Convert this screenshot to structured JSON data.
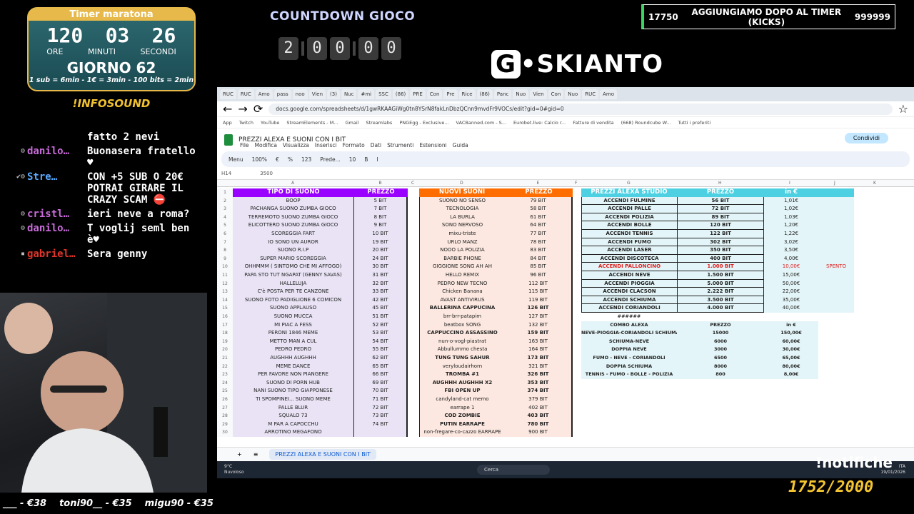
{
  "timer": {
    "title": "Timer maratona",
    "hours": "120",
    "minutes": "03",
    "seconds": "26",
    "hours_label": "ORE",
    "minutes_label": "MINUTI",
    "seconds_label": "SECONDI",
    "day": "GIORNO 62",
    "rates": "1 sub = 6min - 1€ = 3min - 100 bits = 2min"
  },
  "infosound": "!INFOSOUND",
  "chat": [
    {
      "badge": "",
      "user": "",
      "user_color": "#ffffff",
      "msg": "fatto 2 nevi"
    },
    {
      "badge": "⚙",
      "user": "danilo…",
      "user_color": "#c86bd9",
      "msg": "Buonasera fratello ♥"
    },
    {
      "badge": "✔⚙",
      "user": "Stre…",
      "user_color": "#5aa9ff",
      "msg": "CON +5 SUB O 20€ POTRAI GIRARE IL CRAZY SCAM ⛔"
    },
    {
      "badge": "⚙",
      "user": "cristl…",
      "user_color": "#c86bd9",
      "msg": "ieri neve a roma?"
    },
    {
      "badge": "⚙",
      "user": "danilo…",
      "user_color": "#c86bd9",
      "msg": "T voglij seml ben è♥"
    },
    {
      "badge": "▪",
      "user": "gabriel…",
      "user_color": "#e0352b",
      "msg": "Sera genny"
    }
  ],
  "countdown": {
    "title": "COUNTDOWN GIOCO",
    "digits": [
      "2",
      "0",
      "0",
      "0",
      "0"
    ]
  },
  "logo": {
    "g": "G",
    "text": "•SKIANTO"
  },
  "goal": {
    "left": "17750",
    "text": "AGGIUNGIAMO DOPO AL TIMER (KICKS)",
    "right": "999999"
  },
  "browser": {
    "tabs": [
      "RUC",
      "RUC",
      "Amo",
      "pass",
      "noo",
      "Vien",
      "(3)",
      "Nuc",
      "#mi",
      "SSC",
      "(86)",
      "PRE",
      "Con",
      "Pre",
      "Rice",
      "(86)",
      "Panc",
      "Nuo",
      "Vien",
      "Con",
      "Nuo",
      "RUC",
      "Amo"
    ],
    "url": "docs.google.com/spreadsheets/d/1gwRKAAGiWg0tn8YSrN8fakLnDbzQCnn9mvdFr9VOCs/edit?gid=0#gid=0",
    "bookmarks": [
      "App",
      "Twitch",
      "YouTube",
      "StreamElements - M...",
      "Gmail",
      "Streamlabs",
      "PNGEgg - Exclusive...",
      "VACBanned.com - S...",
      "Eurobet.live: Calcio r...",
      "Fatture di vendita",
      "(668) Roundcube W...",
      "Tutti i preferiti"
    ],
    "doc_title": "PREZZI ALEXA E SUONI CON I BIT",
    "menus": [
      "File",
      "Modifica",
      "Visualizza",
      "Inserisci",
      "Formato",
      "Dati",
      "Strumenti",
      "Estensioni",
      "Guida"
    ],
    "share": "Condividi",
    "toolbar": [
      "Menu",
      "100%",
      "€",
      "%",
      "123",
      "Prede...",
      "10",
      "B",
      "I"
    ],
    "cell_ref": "H14",
    "formula": "3500",
    "sheet_tab": "PREZZI ALEXA E SUONI CON I BIT",
    "taskbar_search": "Cerca",
    "weather": [
      "9°C",
      "Nuvoloso"
    ],
    "clock": [
      "ITA",
      "19/01/2026"
    ]
  },
  "sheet": {
    "col_letters": [
      "A",
      "B",
      "C",
      "D",
      "E",
      "F",
      "G",
      "H",
      "I",
      "J",
      "K"
    ],
    "headers": {
      "a": "TIPO DI SUONO",
      "b": "PREZZO",
      "d": "NUOVI SUONI",
      "e": "PREZZO",
      "g": "PREZZI ALEXA STUDIO",
      "h": "PREZZO",
      "i": "in €"
    },
    "colors": {
      "purple": "#9900ff",
      "orange": "#ff6d01",
      "teal": "#4dd0e1",
      "lilac": "#e9e3f5",
      "peach": "#fce8e0",
      "lightblue": "#e3f5f8"
    },
    "rows": [
      {
        "a": "BOOP",
        "b": "5 BIT",
        "d": "SUONO NO SENSO",
        "e": "79 BIT",
        "g": "ACCENDI FULMINE",
        "h": "56 BIT",
        "i": "1,01€",
        "j": ""
      },
      {
        "a": "PACHANGA SUONO ZUMBA GIOCO",
        "b": "7 BIT",
        "d": "TECNOLOGIA",
        "e": "58 BIT",
        "g": "ACCENDI PALLE",
        "h": "72 BIT",
        "i": "1,02€",
        "j": ""
      },
      {
        "a": "TERREMOTO SUONO ZUMBA GIOCO",
        "b": "8 BIT",
        "d": "LA BURLA",
        "e": "61 BIT",
        "g": "ACCENDI POLIZIA",
        "h": "89 BIT",
        "i": "1,03€",
        "j": ""
      },
      {
        "a": "ELICOTTERO SUONO ZUMBA GIOCO",
        "b": "9 BIT",
        "d": "SONO NERVOSO",
        "e": "64 BIT",
        "g": "ACCENDI BOLLE",
        "h": "120 BIT",
        "i": "1,20€",
        "j": ""
      },
      {
        "a": "SCOREGGIA FART",
        "b": "10 BIT",
        "d": "mixu-triste",
        "e": "77 BIT",
        "g": "ACCENDI TENNIS",
        "h": "122 BIT",
        "i": "1,22€",
        "j": ""
      },
      {
        "a": "IO SONO UN AUROR",
        "b": "19 BIT",
        "d": "URLO MANZ",
        "e": "78 BIT",
        "g": "ACCENDI FUMO",
        "h": "302 BIT",
        "i": "3,02€",
        "j": ""
      },
      {
        "a": "SUONO R.I.P",
        "b": "20 BIT",
        "d": "NOOO LA POLIZIA",
        "e": "83 BIT",
        "g": "ACCENDI LASER",
        "h": "350 BIT",
        "i": "3,50€",
        "j": ""
      },
      {
        "a": "SUPER MARIO SCOREGGIA",
        "b": "24 BIT",
        "d": "BARBIE PHONE",
        "e": "84 BIT",
        "g": "ACCENDI DISCOTECA",
        "h": "400 BIT",
        "i": "4,00€",
        "j": ""
      },
      {
        "a": "OHHMMM ( SINTOMO CHE MI AFFOGO)",
        "b": "30 BIT",
        "d": "GIGGIONE SONG AH AH",
        "e": "85 BIT",
        "g": "ACCENDI PALLONCINO",
        "h": "1.000 BIT",
        "i": "10,00€",
        "j": "SPENTO"
      },
      {
        "a": "PAPA STO TUT NGAPAT (GENNY SAVAS)",
        "b": "31 BIT",
        "d": "HELLO REMIX",
        "e": "96 BIT",
        "g": "ACCENDI NEVE",
        "h": "1.500 BIT",
        "i": "15,00€",
        "j": ""
      },
      {
        "a": "HALLELUJA",
        "b": "32 BIT",
        "d": "PEDRO NEW TECNO",
        "e": "112 BIT",
        "g": "ACCENDI PIOGGIA",
        "h": "5.000 BIT",
        "i": "50,00€",
        "j": ""
      },
      {
        "a": "C'è POSTA PER TE CANZONE",
        "b": "33 BIT",
        "d": "Chicken Banana",
        "e": "115 BIT",
        "g": "ACCENDI CLACSON",
        "h": "2.222 BIT",
        "i": "22,00€",
        "j": ""
      },
      {
        "a": "SUONO FOTO PADIGLIONE 6 COMICON",
        "b": "42 BIT",
        "d": "AVAST ANTIVIRUS",
        "e": "119 BIT",
        "g": "ACCENDI SCHIUMA",
        "h": "3.500 BIT",
        "i": "35,00€",
        "j": ""
      },
      {
        "a": "SUONO APPLAUSO",
        "b": "45 BIT",
        "d": "BALLERINA CAPPUCINA",
        "e": "126 BIT",
        "g": "ACCENDI CORIANDOLI",
        "h": "4.000 BIT",
        "i": "40,00€",
        "j": ""
      },
      {
        "a": "SUONO MUCCA",
        "b": "51 BIT",
        "d": "brr-brr-patapim",
        "e": "127 BIT",
        "g": "######",
        "h": "",
        "i": "",
        "j": ""
      },
      {
        "a": "MI PIAC A FESS",
        "b": "52 BIT",
        "d": "beatbox SONG",
        "e": "132 BIT",
        "g": "COMBO ALEXA",
        "h": "PREZZO",
        "i": "in €",
        "j": ""
      },
      {
        "a": "PERONI 1846 MEME",
        "b": "53 BIT",
        "d": "CAPPUCCINO ASSASSINO",
        "e": "159 BIT",
        "g": "NEVE-PIOGGIA-CORIANDOLI SCHIUMA",
        "h": "15000",
        "i": "150,00€",
        "j": ""
      },
      {
        "a": "METTO MAN A CUL",
        "b": "54 BIT",
        "d": "nun-o-vogl-piastrat",
        "e": "163 BIT",
        "g": "SCHIUMA-NEVE",
        "h": "6000",
        "i": "60,00€",
        "j": ""
      },
      {
        "a": "PEDRO PEDRO",
        "b": "55 BIT",
        "d": "Abbullummo chesta",
        "e": "164 BIT",
        "g": "DOPPIA NEVE",
        "h": "3000",
        "i": "30,00€",
        "j": ""
      },
      {
        "a": "AUGHHH AUGHHH",
        "b": "62 BIT",
        "d": "TUNG TUNG SAHUR",
        "e": "173 BIT",
        "g": "FUMO - NEVE - CORIANDOLI",
        "h": "6500",
        "i": "65,00€",
        "j": ""
      },
      {
        "a": "MEME DANCE",
        "b": "65 BIT",
        "d": "veryloudairhorn",
        "e": "321 BIT",
        "g": "DOPPIA SCHIUMA",
        "h": "8000",
        "i": "80,00€",
        "j": ""
      },
      {
        "a": "PER FAVORE NON PIANGERE",
        "b": "66 BIT",
        "d": "TROMBA #1",
        "e": "326 BIT",
        "g": "TENNIS - FUMO - BOLLE - POLIZIA",
        "h": "800",
        "i": "8,00€",
        "j": ""
      },
      {
        "a": "SUONO DI PORN HUB",
        "b": "69 BIT",
        "d": "AUGHHH AUGHHH X2",
        "e": "353 BIT",
        "g": "",
        "h": "",
        "i": "",
        "j": ""
      },
      {
        "a": "NANI SUONO TIPO GIAPPONESE",
        "b": "70 BIT",
        "d": "FBI OPEN UP",
        "e": "374 BIT",
        "g": "",
        "h": "",
        "i": "",
        "j": ""
      },
      {
        "a": "TI SPOMPINEI... SUONO MEME",
        "b": "71 BIT",
        "d": "candyland-cat memo",
        "e": "379 BIT",
        "g": "",
        "h": "",
        "i": "",
        "j": ""
      },
      {
        "a": "PALLE BLUR",
        "b": "72 BIT",
        "d": "earrape 1",
        "e": "402 BIT",
        "g": "",
        "h": "",
        "i": "",
        "j": ""
      },
      {
        "a": "SQUALO 73",
        "b": "73 BIT",
        "d": "COD ZOMBIE",
        "e": "403 BIT",
        "g": "",
        "h": "",
        "i": "",
        "j": ""
      },
      {
        "a": "M PAR A CAPOCCHU",
        "b": "74 BIT",
        "d": "PUTIN EARRAPE",
        "e": "780 BIT",
        "g": "",
        "h": "",
        "i": "",
        "j": ""
      },
      {
        "a": "ARROTINO MEGAFONO",
        "b": "",
        "d": "non-fregare-co-cazzo EARRAPE",
        "e": "900 BIT",
        "g": "",
        "h": "",
        "i": "",
        "j": ""
      }
    ]
  },
  "notifiche": "!notifiche",
  "subgoal": "1752/2000",
  "ticker": [
    "___ - €38",
    "toni90__ - €35",
    "migu90 - €35"
  ]
}
